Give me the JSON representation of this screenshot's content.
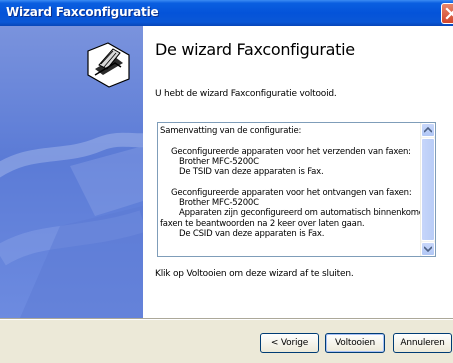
{
  "window": {
    "title": "Wizard Faxconfiguratie"
  },
  "content": {
    "heading": "De wizard Faxconfiguratie",
    "intro": "U hebt de wizard Faxconfiguratie voltooid.",
    "summary": {
      "title": "Samenvatting van de configuratie:",
      "send_header": "Geconfigureerde apparaten voor het verzenden van faxen:",
      "send_device": "Brother MFC-5200C",
      "send_tsid": "De TSID van deze apparaten is Fax.",
      "receive_header": "Geconfigureerde apparaten voor het ontvangen van faxen:",
      "receive_device": "Brother MFC-5200C",
      "receive_config_1": "Apparaten zijn geconfigureerd om automatisch binnenkomende",
      "receive_config_2": "faxen te beantwoorden na 2 keer over laten gaan.",
      "receive_csid": "De CSID van deze apparaten is Fax."
    },
    "closing": "Klik op Voltooien om deze wizard af te sluiten."
  },
  "buttons": {
    "back": "< Vorige",
    "finish": "Voltooien",
    "cancel": "Annuleren"
  },
  "colors": {
    "titlebar": "#0453d9",
    "sidebar": "#6d8be0",
    "face": "#ece9d8",
    "close": "#d2452c"
  },
  "icons": {
    "wizard": "fax-wizard-icon",
    "close": "close-icon",
    "scroll_up": "scroll-up-arrow-icon",
    "scroll_down": "scroll-down-arrow-icon"
  }
}
